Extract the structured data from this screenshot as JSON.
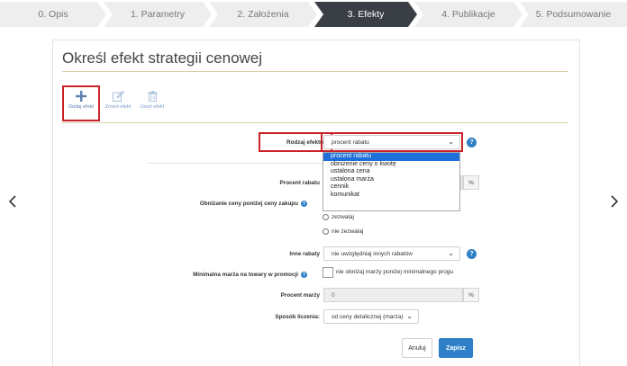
{
  "steps": [
    {
      "label": "0. Opis",
      "active": false
    },
    {
      "label": "1. Parametry",
      "active": false
    },
    {
      "label": "2. Założenia",
      "active": false
    },
    {
      "label": "3. Efekty",
      "active": true
    },
    {
      "label": "4. Publikacje",
      "active": false
    },
    {
      "label": "5. Podsumowanie",
      "active": false
    }
  ],
  "colors": {
    "step_bg": "#eeeeee",
    "step_active_bg": "#3a3f45",
    "accent": "#2f80c8",
    "highlight": "#c9232a"
  },
  "icons": {
    "prev": "chevron-left-icon",
    "next": "chevron-right-icon",
    "add": "plus-icon",
    "edit": "edit-icon",
    "delete": "trash-icon",
    "help": "question-icon"
  },
  "page": {
    "title": "Określ efekt strategii cenowej"
  },
  "toolbar": {
    "add_label": "Dodaj efekt",
    "edit_label": "Zmień efekt",
    "delete_label": "Usuń efekt"
  },
  "form": {
    "effect_type": {
      "label": "Rodzaj efektu:",
      "value": "procent rabatu",
      "options": [
        "procent rabatu",
        "obniżenie ceny o kwotę",
        "ustalona cena",
        "ustalona marża",
        "cennik",
        "komunikat"
      ]
    },
    "discount_percent": {
      "label": "Procent rabatu",
      "unit": "%"
    },
    "below_purchase": {
      "label": "Obniżanie ceny poniżej ceny zakupu",
      "options": [
        "zezwalaj",
        "nie zezwalaj"
      ]
    },
    "other_discounts": {
      "label": "Inne rabaty",
      "value": "nie uwzględniaj innych rabatów"
    },
    "min_margin": {
      "label": "Minimalna marża na towary w promocji",
      "checkbox_label": "nie obniżaj marży poniżej minimalnego progu"
    },
    "margin_percent": {
      "label": "Procent marży",
      "value": "0",
      "unit": "%"
    },
    "calc_method": {
      "label": "Sposób liczenia:",
      "value": "od ceny detalicznej (marża)"
    }
  },
  "buttons": {
    "cancel": "Anuluj",
    "save": "Zapisz"
  }
}
